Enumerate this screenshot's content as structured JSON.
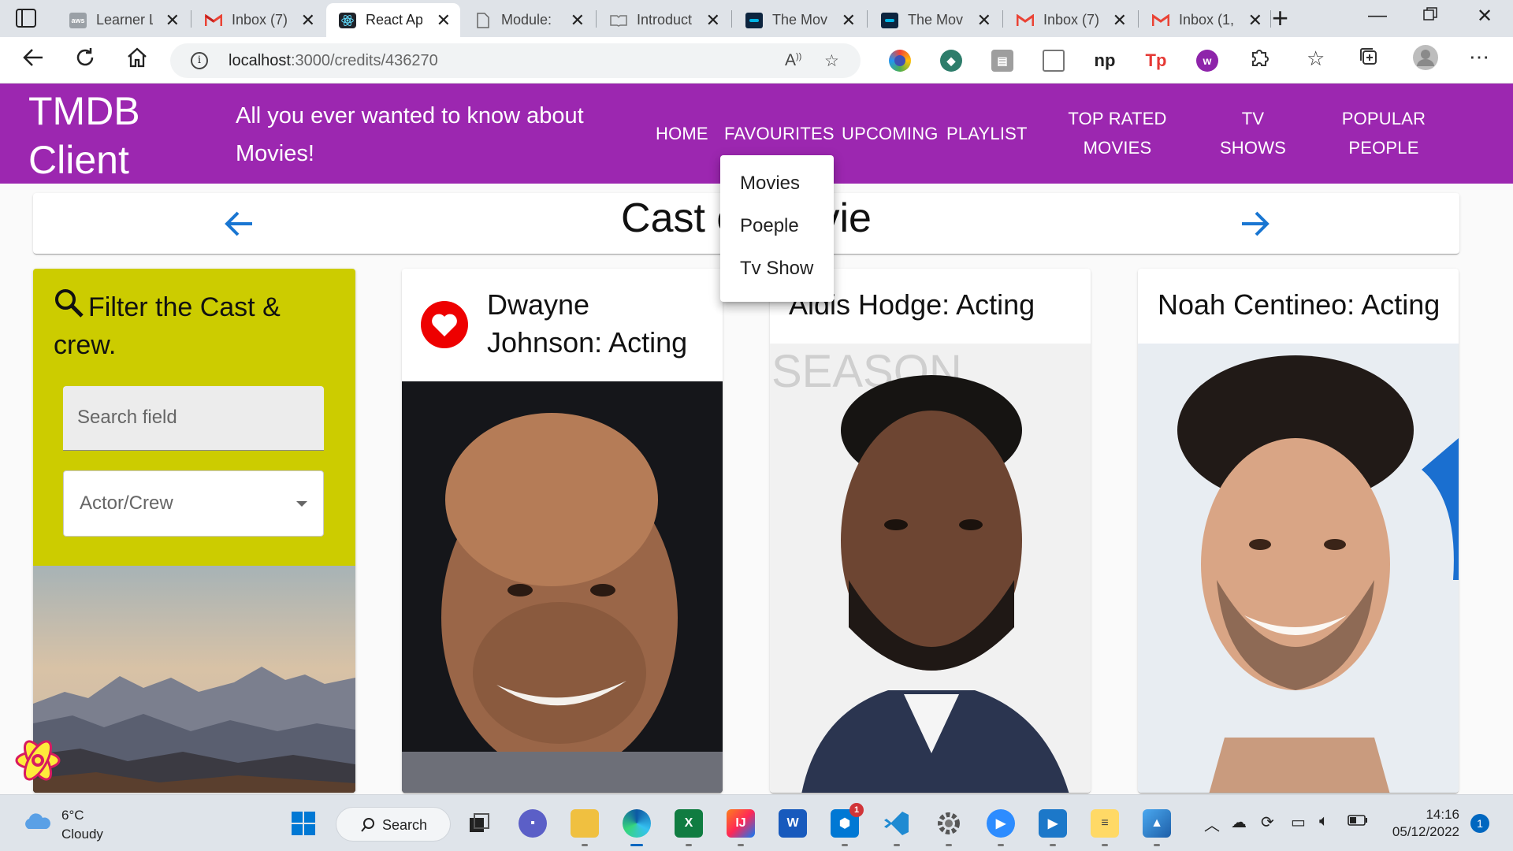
{
  "browser": {
    "tabs": [
      {
        "title": "Learner L",
        "favicon": "aws-icon"
      },
      {
        "title": "Inbox (7)",
        "favicon": "gmail-icon"
      },
      {
        "title": "React Ap",
        "favicon": "react-icon",
        "active": true
      },
      {
        "title": "Module:",
        "favicon": "document-icon"
      },
      {
        "title": "Introduct",
        "favicon": "book-icon"
      },
      {
        "title": "The Mov",
        "favicon": "tmdb-icon"
      },
      {
        "title": "The Mov",
        "favicon": "tmdb-icon"
      },
      {
        "title": "Inbox (7)",
        "favicon": "gmail-icon"
      },
      {
        "title": "Inbox (1,",
        "favicon": "gmail-icon"
      }
    ],
    "url_host": "localhost",
    "url_path": ":3000/credits/436270",
    "colors": {
      "tabbar": "#dfe3e8",
      "header": "#9c27b0"
    }
  },
  "app": {
    "brand": "TMDB Client",
    "tagline": "All you ever wanted to know about Movies!",
    "nav": {
      "home": "HOME",
      "favourites": "FAVOURITES",
      "upcoming": "UPCOMING",
      "playlist": "PLAYLIST",
      "top_rated": "TOP RATED MOVIES",
      "tv_shows": "TV SHOWS",
      "popular_people": "POPULAR PEOPLE"
    },
    "favourites_menu": [
      "Movies",
      "Poeple",
      "Tv Show"
    ],
    "page_title": "Cast of Movie",
    "filter": {
      "title": "Filter the Cast & crew.",
      "search_placeholder": "Search field",
      "select_label": "Actor/Crew"
    },
    "cast": [
      {
        "name": "Dwayne Johnson: Acting",
        "favourite": true
      },
      {
        "name": "Aldis Hodge: Acting",
        "favourite": false
      },
      {
        "name": "Noah Centineo: Acting",
        "favourite": false
      }
    ]
  },
  "taskbar": {
    "weather_temp": "6°C",
    "weather_desc": "Cloudy",
    "search_label": "Search",
    "time": "14:16",
    "date": "05/12/2022",
    "notification_count": "1",
    "store_badge": "1"
  }
}
